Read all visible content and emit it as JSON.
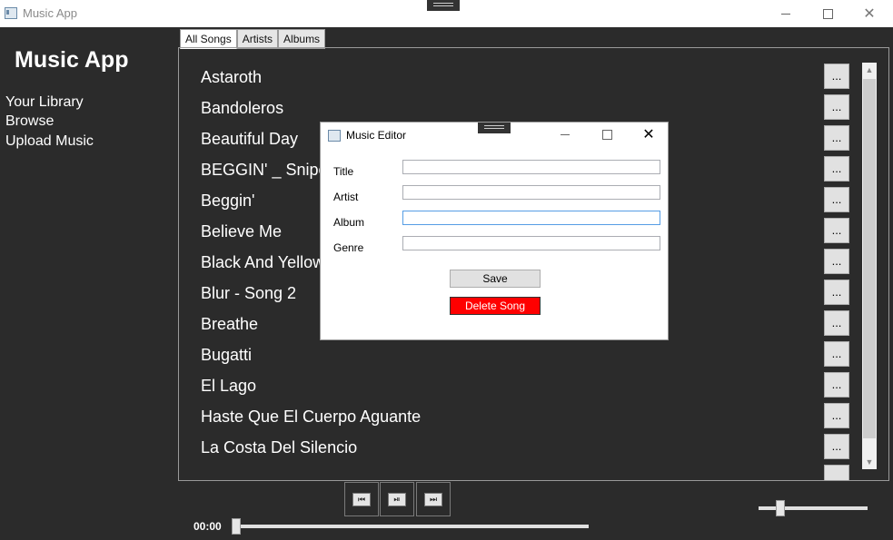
{
  "window": {
    "title": "Music App",
    "icons": [
      "app-icon",
      "minimize-icon",
      "maximize-icon",
      "close-icon"
    ]
  },
  "sidebar": {
    "app_title": "Music App",
    "nav": [
      "Your Library",
      "Browse",
      "Upload Music"
    ]
  },
  "tabs": [
    "All Songs",
    "Artists",
    "Albums"
  ],
  "songs": [
    "Astaroth",
    "Bandoleros",
    "Beautiful Day",
    "BEGGIN' _ Sniper",
    "Beggin'",
    "Believe Me",
    "Black And Yellow",
    "Blur - Song 2",
    "Breathe",
    "Bugatti",
    "El Lago",
    "Haste Que El Cuerpo Aguante",
    "La Costa Del Silencio"
  ],
  "more_label": "...",
  "player": {
    "time": "00:00",
    "controls": [
      "previous-icon",
      "play-pause-icon",
      "next-icon"
    ],
    "progress": 0,
    "volume": 0.2
  },
  "dialog": {
    "title": "Music Editor",
    "fields": [
      {
        "label": "Title",
        "value": ""
      },
      {
        "label": "Artist",
        "value": ""
      },
      {
        "label": "Album",
        "value": ""
      },
      {
        "label": "Genre",
        "value": ""
      }
    ],
    "save_label": "Save",
    "delete_label": "Delete Song"
  },
  "colors": {
    "background": "#2b2b2b",
    "delete": "#ff0000",
    "focus": "#569de5"
  }
}
